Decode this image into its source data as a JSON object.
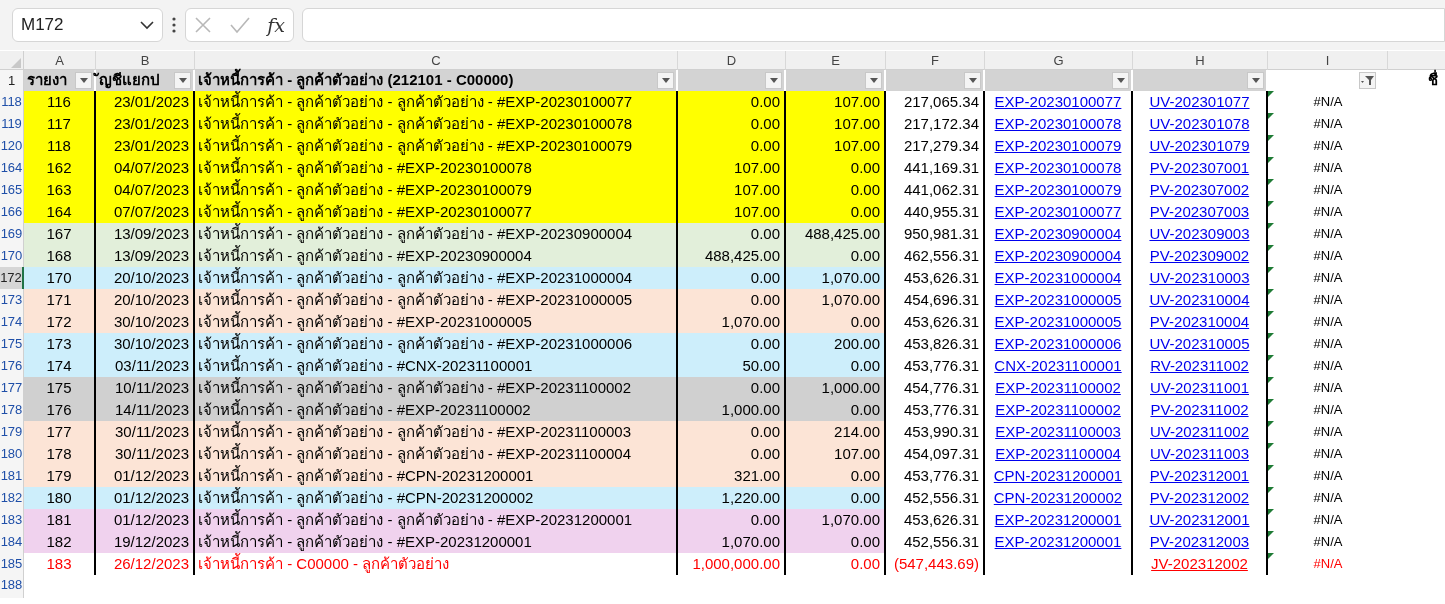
{
  "name_box": {
    "value": "M172"
  },
  "formula_bar": {
    "function_label": "fx"
  },
  "column_letters": [
    "A",
    "B",
    "C",
    "D",
    "E",
    "F",
    "G",
    "H",
    "I"
  ],
  "header_row": {
    "row_number": "1",
    "cells": [
      {
        "text": "รายงา",
        "filtered": false
      },
      {
        "text": "ัญชีแยกป",
        "filtered": false
      },
      {
        "text": "เจ้าหนี้การค้า - ลูกค้าตัวอย่าง (212101 - C00000)",
        "filtered": false
      },
      {
        "filtered": false
      },
      {
        "filtered": false
      },
      {
        "filtered": false
      },
      {
        "filtered": false
      },
      {
        "filtered": false
      },
      {
        "filtered": true
      },
      {
        "text": "ชื่"
      }
    ]
  },
  "rows": [
    {
      "row_number": "118",
      "selected": false,
      "kind": "entry",
      "color": "#ffff00",
      "no": "116",
      "date": "23/01/2023",
      "description": "เจ้าหนี้การค้า - ลูกค้าตัวอย่าง - ลูกค้าตัวอย่าง - #EXP-20230100077",
      "debit": "0.00",
      "credit": "107.00",
      "balance": "217,065.34",
      "doc_ref": "EXP-20230100077",
      "voucher": "UV-202301077",
      "check": "#N/A",
      "error_mark": true
    },
    {
      "row_number": "119",
      "selected": false,
      "kind": "entry",
      "color": "#ffff00",
      "no": "117",
      "date": "23/01/2023",
      "description": "เจ้าหนี้การค้า - ลูกค้าตัวอย่าง - ลูกค้าตัวอย่าง - #EXP-20230100078",
      "debit": "0.00",
      "credit": "107.00",
      "balance": "217,172.34",
      "doc_ref": "EXP-20230100078",
      "voucher": "UV-202301078",
      "check": "#N/A",
      "error_mark": true
    },
    {
      "row_number": "120",
      "selected": false,
      "kind": "entry",
      "color": "#ffff00",
      "no": "118",
      "date": "23/01/2023",
      "description": "เจ้าหนี้การค้า - ลูกค้าตัวอย่าง - ลูกค้าตัวอย่าง - #EXP-20230100079",
      "debit": "0.00",
      "credit": "107.00",
      "balance": "217,279.34",
      "doc_ref": "EXP-20230100079",
      "voucher": "UV-202301079",
      "check": "#N/A",
      "error_mark": true
    },
    {
      "row_number": "164",
      "selected": false,
      "kind": "entry",
      "color": "#ffff00",
      "no": "162",
      "date": "04/07/2023",
      "description": "เจ้าหนี้การค้า - ลูกค้าตัวอย่าง - #EXP-20230100078",
      "debit": "107.00",
      "credit": "0.00",
      "balance": "441,169.31",
      "doc_ref": "EXP-20230100078",
      "voucher": "PV-202307001",
      "check": "#N/A",
      "error_mark": true
    },
    {
      "row_number": "165",
      "selected": false,
      "kind": "entry",
      "color": "#ffff00",
      "no": "163",
      "date": "04/07/2023",
      "description": "เจ้าหนี้การค้า - ลูกค้าตัวอย่าง - #EXP-20230100079",
      "debit": "107.00",
      "credit": "0.00",
      "balance": "441,062.31",
      "doc_ref": "EXP-20230100079",
      "voucher": "PV-202307002",
      "check": "#N/A",
      "error_mark": true
    },
    {
      "row_number": "166",
      "selected": false,
      "kind": "entry",
      "color": "#ffff00",
      "no": "164",
      "date": "07/07/2023",
      "description": "เจ้าหนี้การค้า - ลูกค้าตัวอย่าง - #EXP-20230100077",
      "debit": "107.00",
      "credit": "0.00",
      "balance": "440,955.31",
      "doc_ref": "EXP-20230100077",
      "voucher": "PV-202307003",
      "check": "#N/A",
      "error_mark": true
    },
    {
      "row_number": "169",
      "selected": false,
      "kind": "entry",
      "color": "#e2efda",
      "no": "167",
      "date": "13/09/2023",
      "description": "เจ้าหนี้การค้า - ลูกค้าตัวอย่าง - ลูกค้าตัวอย่าง - #EXP-20230900004",
      "debit": "0.00",
      "credit": "488,425.00",
      "balance": "950,981.31",
      "doc_ref": "EXP-20230900004",
      "voucher": "UV-202309003",
      "check": "#N/A",
      "error_mark": true
    },
    {
      "row_number": "170",
      "selected": false,
      "kind": "entry",
      "color": "#e2efda",
      "no": "168",
      "date": "13/09/2023",
      "description": "เจ้าหนี้การค้า - ลูกค้าตัวอย่าง - #EXP-20230900004",
      "debit": "488,425.00",
      "credit": "0.00",
      "balance": "462,556.31",
      "doc_ref": "EXP-20230900004",
      "voucher": "PV-202309002",
      "check": "#N/A",
      "error_mark": true
    },
    {
      "row_number": "172",
      "selected": true,
      "kind": "entry",
      "color": "#cdeefb",
      "no": "170",
      "date": "20/10/2023",
      "description": "เจ้าหนี้การค้า - ลูกค้าตัวอย่าง - ลูกค้าตัวอย่าง - #EXP-20231000004",
      "debit": "0.00",
      "credit": "1,070.00",
      "balance": "453,626.31",
      "doc_ref": "EXP-20231000004",
      "voucher": "UV-202310003",
      "check": "#N/A",
      "error_mark": true
    },
    {
      "row_number": "173",
      "selected": false,
      "kind": "entry",
      "color": "#fce4d6",
      "no": "171",
      "date": "20/10/2023",
      "description": "เจ้าหนี้การค้า - ลูกค้าตัวอย่าง - ลูกค้าตัวอย่าง - #EXP-20231000005",
      "debit": "0.00",
      "credit": "1,070.00",
      "balance": "454,696.31",
      "doc_ref": "EXP-20231000005",
      "voucher": "UV-202310004",
      "check": "#N/A",
      "error_mark": true
    },
    {
      "row_number": "174",
      "selected": false,
      "kind": "entry",
      "color": "#fce4d6",
      "no": "172",
      "date": "30/10/2023",
      "description": "เจ้าหนี้การค้า - ลูกค้าตัวอย่าง - #EXP-20231000005",
      "debit": "1,070.00",
      "credit": "0.00",
      "balance": "453,626.31",
      "doc_ref": "EXP-20231000005",
      "voucher": "PV-202310004",
      "check": "#N/A",
      "error_mark": true
    },
    {
      "row_number": "175",
      "selected": false,
      "kind": "entry",
      "color": "#cdeefb",
      "no": "173",
      "date": "30/10/2023",
      "description": "เจ้าหนี้การค้า - ลูกค้าตัวอย่าง - ลูกค้าตัวอย่าง - #EXP-20231000006",
      "debit": "0.00",
      "credit": "200.00",
      "balance": "453,826.31",
      "doc_ref": "EXP-20231000006",
      "voucher": "UV-202310005",
      "check": "#N/A",
      "error_mark": true
    },
    {
      "row_number": "176",
      "selected": false,
      "kind": "entry",
      "color": "#cdeefb",
      "no": "174",
      "date": "03/11/2023",
      "description": "เจ้าหนี้การค้า - ลูกค้าตัวอย่าง - #CNX-20231100001",
      "debit": "50.00",
      "credit": "0.00",
      "balance": "453,776.31",
      "doc_ref": "CNX-20231100001",
      "voucher": "RV-202311002",
      "check": "#N/A",
      "error_mark": true
    },
    {
      "row_number": "177",
      "selected": false,
      "kind": "entry",
      "color": "#d0d0d0",
      "no": "175",
      "date": "10/11/2023",
      "description": "เจ้าหนี้การค้า - ลูกค้าตัวอย่าง - ลูกค้าตัวอย่าง - #EXP-20231100002",
      "debit": "0.00",
      "credit": "1,000.00",
      "balance": "454,776.31",
      "doc_ref": "EXP-20231100002",
      "voucher": "UV-202311001",
      "check": "#N/A",
      "error_mark": true
    },
    {
      "row_number": "178",
      "selected": false,
      "kind": "entry",
      "color": "#d0d0d0",
      "no": "176",
      "date": "14/11/2023",
      "description": "เจ้าหนี้การค้า - ลูกค้าตัวอย่าง - #EXP-20231100002",
      "debit": "1,000.00",
      "credit": "0.00",
      "balance": "453,776.31",
      "doc_ref": "EXP-20231100002",
      "voucher": "PV-202311002",
      "check": "#N/A",
      "error_mark": true
    },
    {
      "row_number": "179",
      "selected": false,
      "kind": "entry",
      "color": "#fce4d6",
      "no": "177",
      "date": "30/11/2023",
      "description": "เจ้าหนี้การค้า - ลูกค้าตัวอย่าง - ลูกค้าตัวอย่าง - #EXP-20231100003",
      "debit": "0.00",
      "credit": "214.00",
      "balance": "453,990.31",
      "doc_ref": "EXP-20231100003",
      "voucher": "UV-202311002",
      "check": "#N/A",
      "error_mark": true
    },
    {
      "row_number": "180",
      "selected": false,
      "kind": "entry",
      "color": "#fce4d6",
      "no": "178",
      "date": "30/11/2023",
      "description": "เจ้าหนี้การค้า - ลูกค้าตัวอย่าง - ลูกค้าตัวอย่าง - #EXP-20231100004",
      "debit": "0.00",
      "credit": "107.00",
      "balance": "454,097.31",
      "doc_ref": "EXP-20231100004",
      "voucher": "UV-202311003",
      "check": "#N/A",
      "error_mark": true
    },
    {
      "row_number": "181",
      "selected": false,
      "kind": "entry",
      "color": "#fce4d6",
      "no": "179",
      "date": "01/12/2023",
      "description": "เจ้าหนี้การค้า - ลูกค้าตัวอย่าง - #CPN-20231200001",
      "debit": "321.00",
      "credit": "0.00",
      "balance": "453,776.31",
      "doc_ref": "CPN-20231200001",
      "voucher": "PV-202312001",
      "check": "#N/A",
      "error_mark": true
    },
    {
      "row_number": "182",
      "selected": false,
      "kind": "entry",
      "color": "#cdeefb",
      "no": "180",
      "date": "01/12/2023",
      "description": "เจ้าหนี้การค้า - ลูกค้าตัวอย่าง - #CPN-20231200002",
      "debit": "1,220.00",
      "credit": "0.00",
      "balance": "452,556.31",
      "doc_ref": "CPN-20231200002",
      "voucher": "PV-202312002",
      "check": "#N/A",
      "error_mark": true
    },
    {
      "row_number": "183",
      "selected": false,
      "kind": "entry",
      "color": "#f0d2ee",
      "no": "181",
      "date": "01/12/2023",
      "description": "เจ้าหนี้การค้า - ลูกค้าตัวอย่าง - ลูกค้าตัวอย่าง - #EXP-20231200001",
      "debit": "0.00",
      "credit": "1,070.00",
      "balance": "453,626.31",
      "doc_ref": "EXP-20231200001",
      "voucher": "UV-202312001",
      "check": "#N/A",
      "error_mark": true
    },
    {
      "row_number": "184",
      "selected": false,
      "kind": "entry",
      "color": "#f0d2ee",
      "no": "182",
      "date": "19/12/2023",
      "description": "เจ้าหนี้การค้า - ลูกค้าตัวอย่าง - #EXP-20231200001",
      "debit": "1,070.00",
      "credit": "0.00",
      "balance": "452,556.31",
      "doc_ref": "EXP-20231200001",
      "voucher": "PV-202312003",
      "check": "#N/A",
      "error_mark": true
    },
    {
      "row_number": "185",
      "selected": false,
      "kind": "alert",
      "no": "183",
      "date": "26/12/2023",
      "description": "เจ้าหนี้การค้า - C00000 - ลูกค้าตัวอย่าง",
      "debit": "1,000,000.00",
      "credit": "0.00",
      "balance": "(547,443.69)",
      "voucher": "JV-202312002",
      "check": "#N/A",
      "error_mark": true
    }
  ],
  "empty_rows": [
    {
      "row_number": "188",
      "selected": false
    }
  ]
}
